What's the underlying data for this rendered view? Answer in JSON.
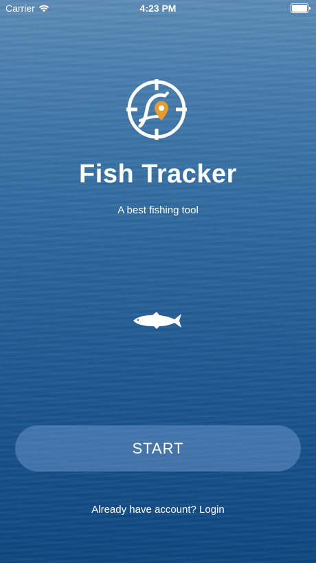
{
  "status_bar": {
    "carrier": "Carrier",
    "time": "4:23 PM",
    "wifi_icon": "wifi-icon",
    "battery_icon": "battery-icon"
  },
  "app": {
    "logo_icon": "fish-location-crosshair-icon",
    "title": "Fish Tracker",
    "subtitle": "A best fishing tool",
    "decoration_icon": "tuna-fish-icon"
  },
  "actions": {
    "start_label": "START",
    "login_label": "Already have account? Login"
  },
  "colors": {
    "accent_orange": "#e89a2c",
    "button_fill": "#6f98c8",
    "text": "#ffffff"
  }
}
